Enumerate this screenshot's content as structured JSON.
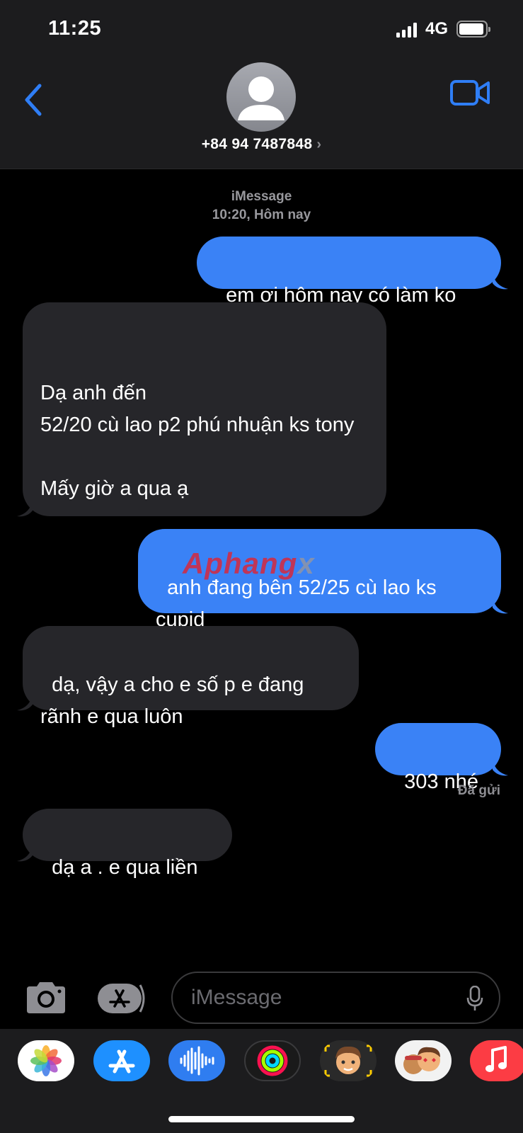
{
  "status_bar": {
    "time": "11:25",
    "network": "4G",
    "signal_bars": 4,
    "battery_level": 0.9
  },
  "header": {
    "contact": "+84 94 7487848",
    "chevron": "›"
  },
  "thread": {
    "service": "iMessage",
    "timestamp": "10:20, Hôm nay",
    "messages": [
      {
        "direction": "outgoing",
        "text": "em ơi hôm nay có làm ko"
      },
      {
        "direction": "incoming",
        "text": "\nDạ anh đến\n52/20 cù lao p2 phú nhuận ks tony\n\nMấy giờ a qua ạ"
      },
      {
        "direction": "outgoing",
        "text": "anh đang bên 52/25 cù lao ks cupid"
      },
      {
        "direction": "incoming",
        "text": "dạ, vậy a cho e số p e đang rãnh e qua luôn"
      },
      {
        "direction": "outgoing",
        "text": "303 nhé"
      },
      {
        "direction": "incoming",
        "text": "dạ a . e qua liền"
      }
    ],
    "delivered_label": "Đã gửi"
  },
  "watermark": {
    "brand": "Aphang",
    "suffix": "x"
  },
  "composer": {
    "placeholder": "iMessage"
  },
  "drawer": {
    "apps": [
      {
        "name": "photos",
        "color": "#ffffff"
      },
      {
        "name": "app-store",
        "color": "#1e90ff"
      },
      {
        "name": "audio-message",
        "color": "#2f7df0"
      },
      {
        "name": "activity",
        "color": "#1a1a1a"
      },
      {
        "name": "memoji",
        "color": "#2a2a2a"
      },
      {
        "name": "memoji-stickers",
        "color": "#f2f2f2"
      },
      {
        "name": "music",
        "color": "#fc3c44"
      }
    ]
  },
  "colors": {
    "outgoing_bubble": "#3a82f6",
    "incoming_bubble": "#26262a",
    "accent": "#2f7ef6"
  }
}
